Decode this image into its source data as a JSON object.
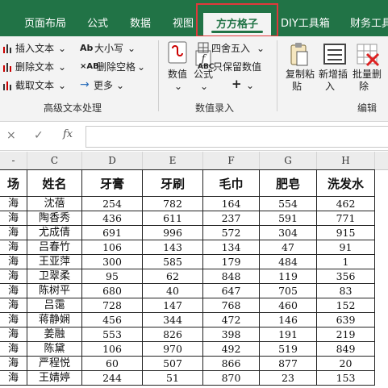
{
  "tabs": [
    "页面布局",
    "公式",
    "数据",
    "视图",
    "方方格子",
    "DIY工具箱",
    "财务工具"
  ],
  "ribbon": {
    "text_group": {
      "items": [
        "插入文本",
        "删除文本",
        "截取文本"
      ],
      "size_button": "大小写",
      "delete_space": "删除空格",
      "more": "更多",
      "label": "高级文本处理"
    },
    "numeric_group": {
      "numeric": "数值",
      "formula": "公式",
      "round": "四舍五入",
      "keep_value": "只保留数值",
      "label": "数值录入"
    },
    "edit_group": {
      "copy_paste_1": "复制粘",
      "copy_paste_2": "贴",
      "insert_1": "新增插",
      "insert_2": "入",
      "batch_delete_1": "批量删",
      "batch_delete_2": "除",
      "label": "编辑"
    }
  },
  "formula_bar": {
    "cancel": "×",
    "confirm": "✓",
    "fx": "fx",
    "value": ""
  },
  "columns": [
    "C",
    "D",
    "E",
    "F",
    "G",
    "H"
  ],
  "headers": [
    "场",
    "姓名",
    "牙膏",
    "牙刷",
    "毛巾",
    "肥皂",
    "洗发水"
  ],
  "rows": [
    [
      "海",
      "沈蓓",
      "254",
      "782",
      "164",
      "554",
      "462"
    ],
    [
      "海",
      "陶香秀",
      "436",
      "611",
      "237",
      "591",
      "771"
    ],
    [
      "海",
      "尤成倩",
      "691",
      "996",
      "572",
      "304",
      "915"
    ],
    [
      "海",
      "吕春竹",
      "106",
      "143",
      "134",
      "47",
      "91"
    ],
    [
      "海",
      "王亚萍",
      "300",
      "585",
      "179",
      "484",
      "1"
    ],
    [
      "海",
      "卫翠柔",
      "95",
      "62",
      "848",
      "119",
      "356"
    ],
    [
      "海",
      "陈树平",
      "680",
      "40",
      "647",
      "705",
      "83"
    ],
    [
      "海",
      "吕霭",
      "728",
      "147",
      "768",
      "460",
      "152"
    ],
    [
      "海",
      "蒋静娴",
      "456",
      "344",
      "472",
      "146",
      "639"
    ],
    [
      "海",
      "姜融",
      "553",
      "826",
      "398",
      "191",
      "219"
    ],
    [
      "海",
      "陈黛",
      "106",
      "970",
      "492",
      "519",
      "849"
    ],
    [
      "海",
      "严程悦",
      "60",
      "507",
      "866",
      "877",
      "20"
    ],
    [
      "海",
      "王婧婷",
      "244",
      "51",
      "870",
      "23",
      "153"
    ]
  ]
}
